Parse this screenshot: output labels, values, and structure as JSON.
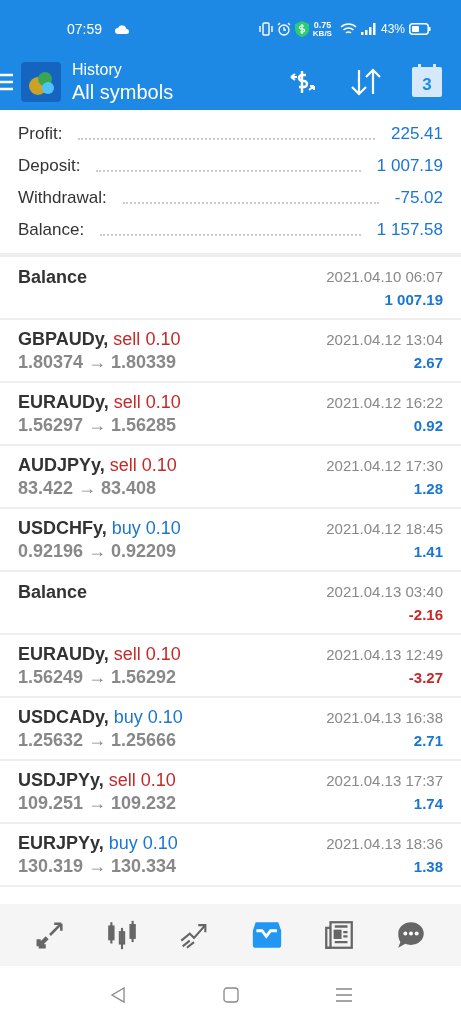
{
  "status_bar": {
    "time": "07:59",
    "speed": "0.75",
    "speed_unit": "KB/S",
    "battery": "43%"
  },
  "header": {
    "title": "History",
    "subtitle": "All symbols",
    "calendar_day": "3"
  },
  "summary": [
    {
      "label": "Profit:",
      "value": "225.41",
      "negative": false
    },
    {
      "label": "Deposit:",
      "value": "1 007.19",
      "negative": false
    },
    {
      "label": "Withdrawal:",
      "value": "-75.02",
      "negative": false
    },
    {
      "label": "Balance:",
      "value": "1 157.58",
      "negative": false
    }
  ],
  "deals": [
    {
      "kind": "balance",
      "title": "Balance",
      "time": "2021.04.10 06:07",
      "amount": "1 007.19",
      "loss": false
    },
    {
      "kind": "trade",
      "symbol": "GBPAUDy,",
      "side": "sell",
      "volume": "0.10",
      "prices": "1.80374 → 1.80339",
      "time": "2021.04.12 13:04",
      "amount": "2.67",
      "loss": false
    },
    {
      "kind": "trade",
      "symbol": "EURAUDy,",
      "side": "sell",
      "volume": "0.10",
      "prices": "1.56297 → 1.56285",
      "time": "2021.04.12 16:22",
      "amount": "0.92",
      "loss": false
    },
    {
      "kind": "trade",
      "symbol": "AUDJPYy,",
      "side": "sell",
      "volume": "0.10",
      "prices": "83.422 → 83.408",
      "time": "2021.04.12 17:30",
      "amount": "1.28",
      "loss": false
    },
    {
      "kind": "trade",
      "symbol": "USDCHFy,",
      "side": "buy",
      "volume": "0.10",
      "prices": "0.92196 → 0.92209",
      "time": "2021.04.12 18:45",
      "amount": "1.41",
      "loss": false
    },
    {
      "kind": "balance",
      "title": "Balance",
      "time": "2021.04.13 03:40",
      "amount": "-2.16",
      "loss": true
    },
    {
      "kind": "trade",
      "symbol": "EURAUDy,",
      "side": "sell",
      "volume": "0.10",
      "prices": "1.56249 → 1.56292",
      "time": "2021.04.13 12:49",
      "amount": "-3.27",
      "loss": true
    },
    {
      "kind": "trade",
      "symbol": "USDCADy,",
      "side": "buy",
      "volume": "0.10",
      "prices": "1.25632 → 1.25666",
      "time": "2021.04.13 16:38",
      "amount": "2.71",
      "loss": false
    },
    {
      "kind": "trade",
      "symbol": "USDJPYy,",
      "side": "sell",
      "volume": "0.10",
      "prices": "109.251 → 109.232",
      "time": "2021.04.13 17:37",
      "amount": "1.74",
      "loss": false
    },
    {
      "kind": "trade",
      "symbol": "EURJPYy,",
      "side": "buy",
      "volume": "0.10",
      "prices": "130.319 → 130.334",
      "time": "2021.04.13 18:36",
      "amount": "1.38",
      "loss": false
    }
  ],
  "bottom_nav": [
    {
      "kind": "quotes",
      "selected": false
    },
    {
      "kind": "chart",
      "selected": false
    },
    {
      "kind": "trade",
      "selected": false
    },
    {
      "kind": "history",
      "selected": true
    },
    {
      "kind": "news",
      "selected": false
    },
    {
      "kind": "messages",
      "selected": false
    }
  ]
}
